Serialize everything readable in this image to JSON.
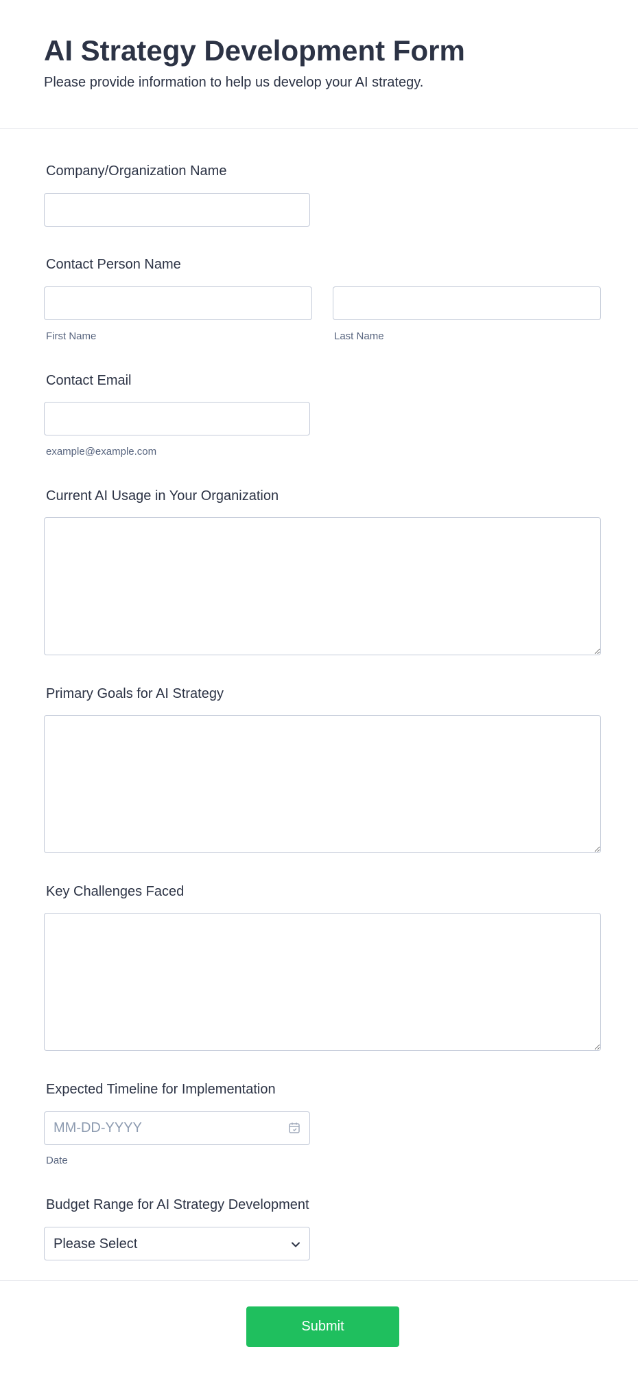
{
  "header": {
    "title": "AI Strategy Development Form",
    "subtitle": "Please provide information to help us develop your AI strategy."
  },
  "fields": {
    "company": {
      "label": "Company/Organization Name",
      "value": ""
    },
    "contact_person": {
      "label": "Contact Person Name",
      "first_name_sublabel": "First Name",
      "last_name_sublabel": "Last Name",
      "first_value": "",
      "last_value": ""
    },
    "email": {
      "label": "Contact Email",
      "sublabel": "example@example.com",
      "value": ""
    },
    "current_usage": {
      "label": "Current AI Usage in Your Organization",
      "value": ""
    },
    "primary_goals": {
      "label": "Primary Goals for AI Strategy",
      "value": ""
    },
    "challenges": {
      "label": "Key Challenges Faced",
      "value": ""
    },
    "timeline": {
      "label": "Expected Timeline for Implementation",
      "placeholder": "MM-DD-YYYY",
      "sublabel": "Date",
      "icon": "calendar-icon"
    },
    "budget": {
      "label": "Budget Range for AI Strategy Development",
      "selected": "Please Select",
      "icon": "chevron-down-icon"
    }
  },
  "footer": {
    "submit_label": "Submit"
  },
  "colors": {
    "text": "#2c3345",
    "border": "#c3cad8",
    "submit_bg": "#1fbf5e",
    "placeholder": "#8d9bb0"
  }
}
